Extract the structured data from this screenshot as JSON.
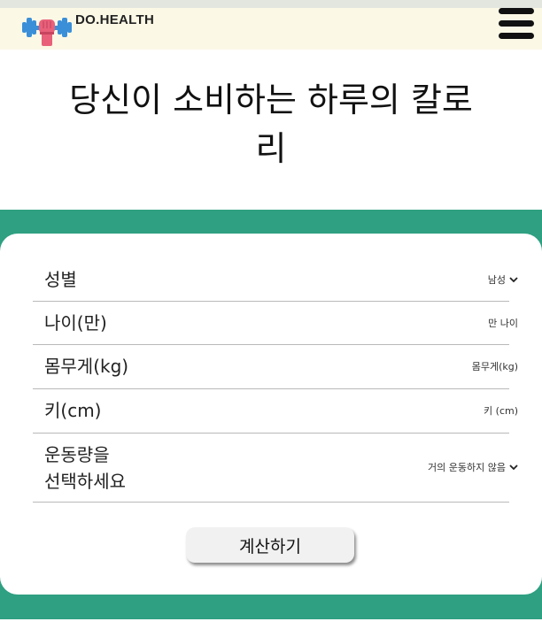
{
  "header": {
    "brand": "DO.HEALTH",
    "menu_icon": "hamburger-icon",
    "logo_icon": "dumbbell-fist-icon"
  },
  "hero": {
    "title_line1": "당신이 소비하는 하루의 칼로",
    "title_line2": "리"
  },
  "form": {
    "fields": [
      {
        "label": "성별",
        "value": "남성",
        "type": "select"
      },
      {
        "label": "나이(만)",
        "value": "만 나이",
        "type": "input"
      },
      {
        "label": "몸무게(kg)",
        "value": "몸무게(kg)",
        "type": "input"
      },
      {
        "label": "키(cm)",
        "value": "키 (cm)",
        "type": "input"
      },
      {
        "label_line1": "운동량을",
        "label_line2": "선택하세요",
        "value": "거의 운동하지 않음",
        "type": "select"
      }
    ],
    "submit_label": "계산하기"
  },
  "colors": {
    "accent_green": "#2fa082",
    "header_bg": "#fbf8e6",
    "logo_blue": "#3a8fd8",
    "logo_pink": "#e8607a"
  }
}
